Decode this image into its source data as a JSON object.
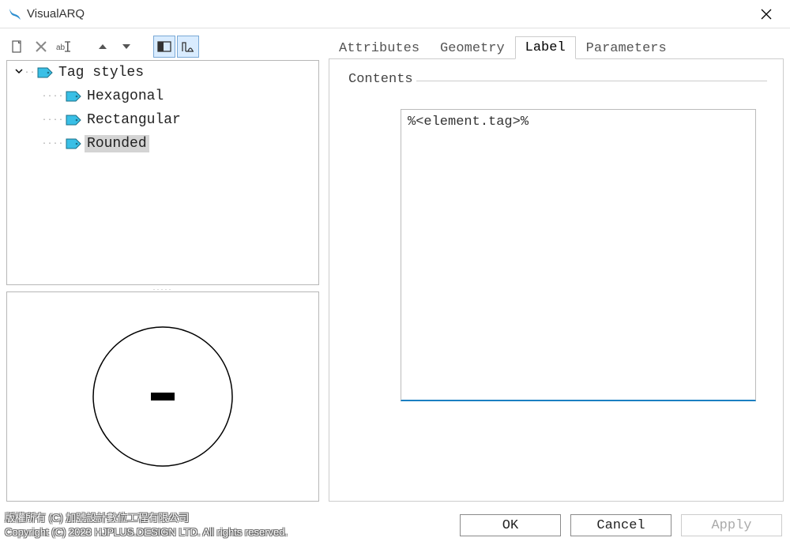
{
  "window": {
    "title": "VisualARQ"
  },
  "tree": {
    "root": "Tag styles",
    "items": [
      "Hexagonal",
      "Rectangular",
      "Rounded"
    ],
    "selected_index": 2
  },
  "tabs": {
    "items": [
      "Attributes",
      "Geometry",
      "Label",
      "Parameters"
    ],
    "active_index": 2
  },
  "label_panel": {
    "fieldset": "Contents",
    "value": "%<element.tag>%"
  },
  "buttons": {
    "ok": "OK",
    "cancel": "Cancel",
    "apply": "Apply"
  },
  "copyright": {
    "line1": "版權所有 (C) 加號設計數位工程有限公司",
    "line2": "Copyright (C) 2023 HJPLUS.DESIGN LTD. All rights reserved."
  }
}
